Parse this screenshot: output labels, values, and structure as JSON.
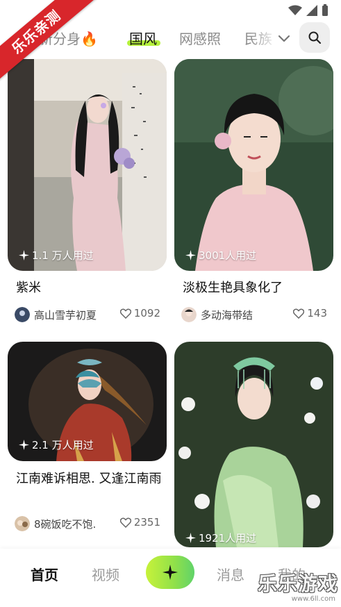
{
  "ribbon": "乐乐亲测",
  "tabs": [
    {
      "label": "最新分身🔥",
      "active": false
    },
    {
      "label": "国风",
      "active": true
    },
    {
      "label": "网感照",
      "active": false
    },
    {
      "label": "民族",
      "active": false
    }
  ],
  "cards": [
    {
      "uses": "1.1 万人用过",
      "title": "紫米",
      "author": "高山雪芋初夏",
      "likes": "1092"
    },
    {
      "uses": "3001人用过",
      "title": "淡极生艳具象化了",
      "author": "多动海带结",
      "likes": "143"
    },
    {
      "uses": "2.1 万人用过",
      "title": "江南难诉相思. 又逢江南雨",
      "author": "8碗饭吃不饱.",
      "likes": "2351"
    },
    {
      "uses": "1921人用过",
      "title": "",
      "author": "",
      "likes": ""
    }
  ],
  "nav": {
    "home": "首页",
    "video": "视频",
    "messages": "消息",
    "mine": "我的"
  },
  "watermark": {
    "text": "乐乐游戏",
    "url": "www.6ll.com"
  },
  "colors": {
    "accent": "#b6f23d",
    "ribbon": "#d8262b"
  }
}
